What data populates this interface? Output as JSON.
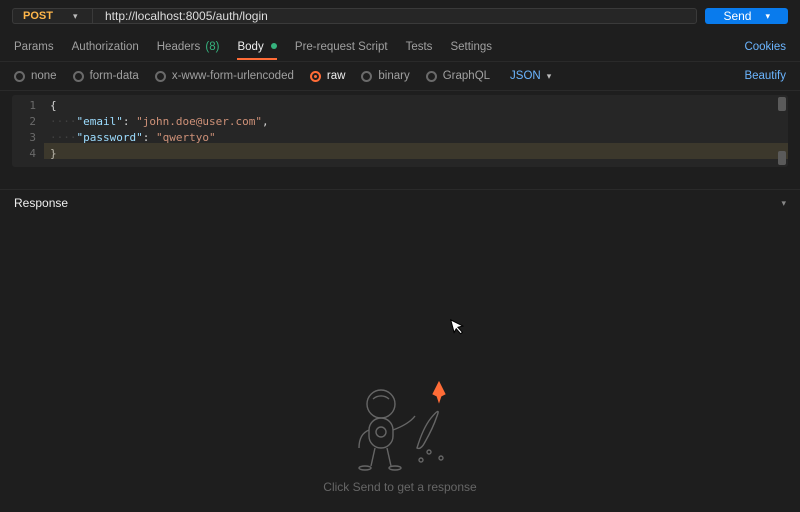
{
  "request": {
    "method": "POST",
    "url": "http://localhost:8005/auth/login",
    "send_label": "Send"
  },
  "tabs": {
    "params": "Params",
    "authorization": "Authorization",
    "headers": "Headers",
    "headers_count": "(8)",
    "body": "Body",
    "prerequest": "Pre-request Script",
    "tests": "Tests",
    "settings": "Settings",
    "cookies": "Cookies"
  },
  "body_types": {
    "none": "none",
    "formdata": "form-data",
    "xwww": "x-www-form-urlencoded",
    "raw": "raw",
    "binary": "binary",
    "graphql": "GraphQL",
    "format": "JSON",
    "beautify": "Beautify"
  },
  "editor": {
    "line_numbers": [
      "1",
      "2",
      "3",
      "4"
    ],
    "l1_open": "{",
    "l2_key": "\"email\"",
    "l2_colon": ": ",
    "l2_val": "\"john.doe@user.com\"",
    "l2_comma": ",",
    "l3_key": "\"password\"",
    "l3_colon": ": ",
    "l3_val": "\"qwertyo\"",
    "l4_close": "}"
  },
  "response": {
    "label": "Response",
    "hint": "Click Send to get a response"
  }
}
